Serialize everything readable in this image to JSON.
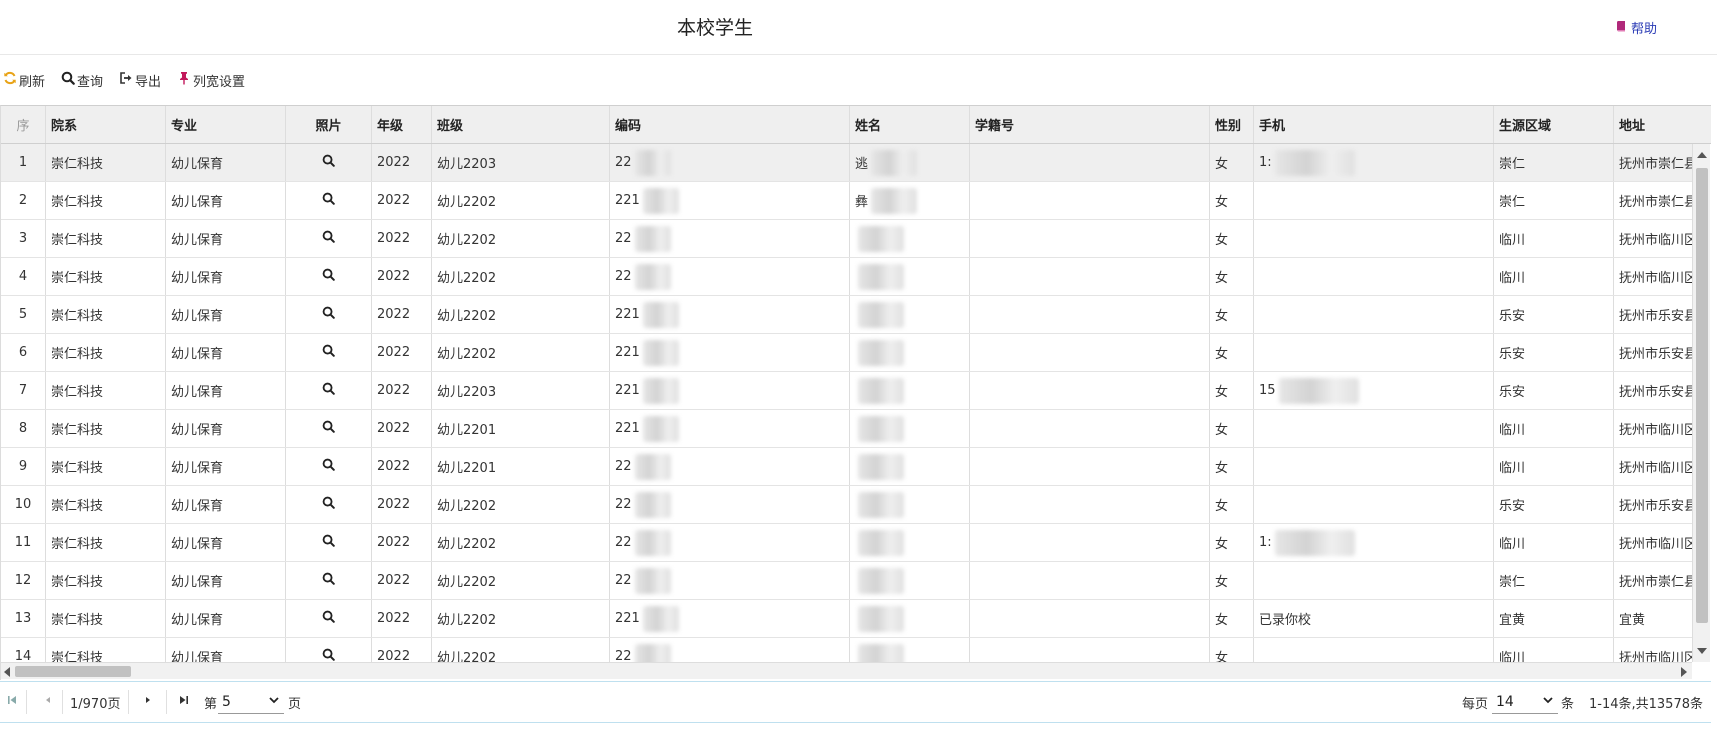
{
  "header": {
    "title": "本校学生",
    "help_label": "帮助"
  },
  "toolbar": {
    "refresh": "刷新",
    "query": "查询",
    "export": "导出",
    "column_width": "列宽设置"
  },
  "columns": {
    "seq": "序",
    "college": "院系",
    "major": "专业",
    "photo": "照片",
    "grade": "年级",
    "class": "班级",
    "code": "编码",
    "name": "姓名",
    "student_no": "学籍号",
    "gender": "性别",
    "phone": "手机",
    "region": "生源区域",
    "address": "地址"
  },
  "rows": [
    {
      "seq": "1",
      "college": "崇仁科技",
      "major": "幼儿保育",
      "grade": "2022",
      "class": "幼儿2203",
      "code": "22",
      "name": "逃",
      "gender": "女",
      "phone": "1:",
      "region": "崇仁",
      "address": "抚州市崇仁县"
    },
    {
      "seq": "2",
      "college": "崇仁科技",
      "major": "幼儿保育",
      "grade": "2022",
      "class": "幼儿2202",
      "code": "221",
      "name": "彝",
      "gender": "女",
      "phone": "",
      "region": "崇仁",
      "address": "抚州市崇仁县"
    },
    {
      "seq": "3",
      "college": "崇仁科技",
      "major": "幼儿保育",
      "grade": "2022",
      "class": "幼儿2202",
      "code": "22",
      "name": "",
      "gender": "女",
      "phone": "",
      "region": "临川",
      "address": "抚州市临川区"
    },
    {
      "seq": "4",
      "college": "崇仁科技",
      "major": "幼儿保育",
      "grade": "2022",
      "class": "幼儿2202",
      "code": "22",
      "name": "",
      "gender": "女",
      "phone": "",
      "region": "临川",
      "address": "抚州市临川区"
    },
    {
      "seq": "5",
      "college": "崇仁科技",
      "major": "幼儿保育",
      "grade": "2022",
      "class": "幼儿2202",
      "code": "221",
      "name": "",
      "gender": "女",
      "phone": "",
      "region": "乐安",
      "address": "抚州市乐安县"
    },
    {
      "seq": "6",
      "college": "崇仁科技",
      "major": "幼儿保育",
      "grade": "2022",
      "class": "幼儿2202",
      "code": "221",
      "name": "",
      "gender": "女",
      "phone": "",
      "region": "乐安",
      "address": "抚州市乐安县"
    },
    {
      "seq": "7",
      "college": "崇仁科技",
      "major": "幼儿保育",
      "grade": "2022",
      "class": "幼儿2203",
      "code": "221",
      "name": "",
      "gender": "女",
      "phone": "15",
      "region": "乐安",
      "address": "抚州市乐安县"
    },
    {
      "seq": "8",
      "college": "崇仁科技",
      "major": "幼儿保育",
      "grade": "2022",
      "class": "幼儿2201",
      "code": "221",
      "name": "",
      "gender": "女",
      "phone": "",
      "region": "临川",
      "address": "抚州市临川区"
    },
    {
      "seq": "9",
      "college": "崇仁科技",
      "major": "幼儿保育",
      "grade": "2022",
      "class": "幼儿2201",
      "code": "22",
      "name": "",
      "gender": "女",
      "phone": "",
      "region": "临川",
      "address": "抚州市临川区"
    },
    {
      "seq": "10",
      "college": "崇仁科技",
      "major": "幼儿保育",
      "grade": "2022",
      "class": "幼儿2202",
      "code": "22",
      "name": "",
      "gender": "女",
      "phone": "",
      "region": "乐安",
      "address": "抚州市乐安县"
    },
    {
      "seq": "11",
      "college": "崇仁科技",
      "major": "幼儿保育",
      "grade": "2022",
      "class": "幼儿2202",
      "code": "22",
      "name": "",
      "gender": "女",
      "phone": "1:",
      "region": "临川",
      "address": "抚州市临川区"
    },
    {
      "seq": "12",
      "college": "崇仁科技",
      "major": "幼儿保育",
      "grade": "2022",
      "class": "幼儿2202",
      "code": "22",
      "name": "",
      "gender": "女",
      "phone": "",
      "region": "崇仁",
      "address": "抚州市崇仁县"
    },
    {
      "seq": "13",
      "college": "崇仁科技",
      "major": "幼儿保育",
      "grade": "2022",
      "class": "幼儿2202",
      "code": "221",
      "name": "",
      "gender": "女",
      "phone": "已录你校",
      "region": "宜黄",
      "address": "宜黄"
    },
    {
      "seq": "14",
      "college": "崇仁科技",
      "major": "幼儿保育",
      "grade": "2022",
      "class": "幼儿2202",
      "code": "22",
      "name": "",
      "gender": "女",
      "phone": "",
      "region": "临川",
      "address": "抚州市临川区"
    }
  ],
  "pager": {
    "page_info": "1/970页",
    "goto_prefix": "第",
    "goto_value": "5",
    "goto_suffix": "页",
    "per_page_prefix": "每页",
    "per_page_value": "14",
    "per_page_suffix": "条",
    "summary": "1-14条,共13578条"
  }
}
